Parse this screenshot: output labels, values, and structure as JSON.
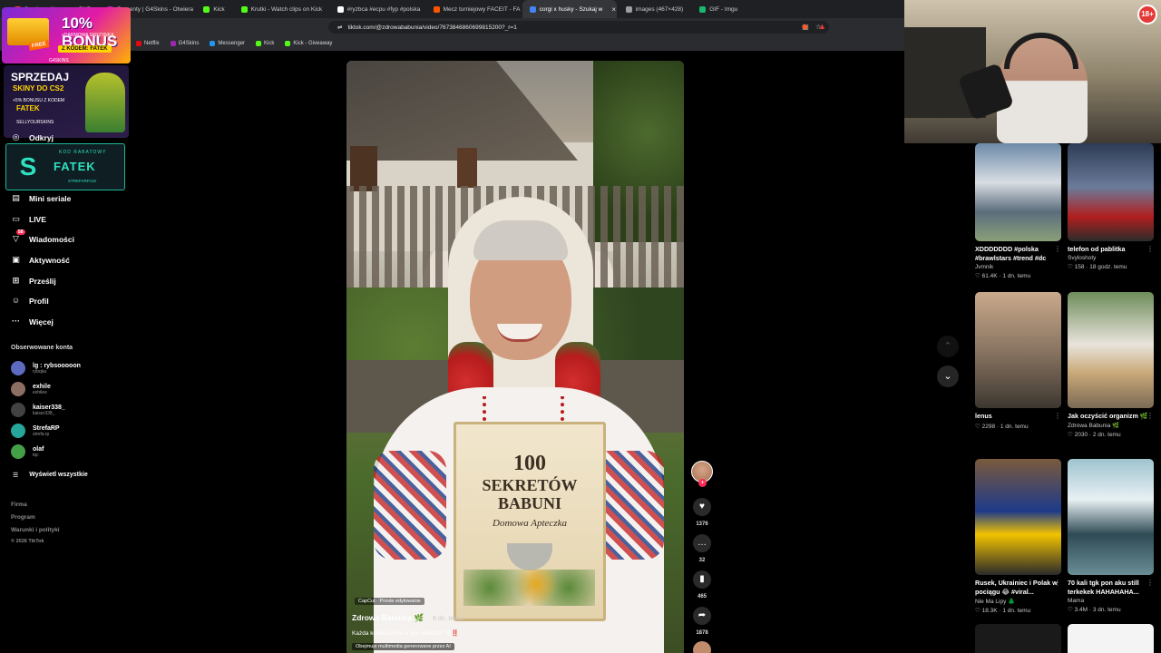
{
  "browser": {
    "tabs": [
      {
        "label": "Sentino x Koneser x BNP",
        "color": "#e53935"
      },
      {
        "label": "Prezenty | G4Skins - Otwiera",
        "color": "#9c27b0"
      },
      {
        "label": "Kick",
        "color": "#53fc18"
      },
      {
        "label": "Krutki - Watch clips on Kick",
        "color": "#53fc18"
      },
      {
        "label": "#ryzbca #ecpu #fyp #polska",
        "color": "#ffffff"
      },
      {
        "label": "Mecz turniejowy FACEIT - FA",
        "color": "#ff5500"
      },
      {
        "label": "corgi x husky - Szukaj w",
        "color": "#4285f4",
        "active": true
      },
      {
        "label": "images (467×428)",
        "color": "#9e9e9e"
      },
      {
        "label": "GIF - Imgu",
        "color": "#1bb76e"
      }
    ],
    "url": "tiktok.com/@zdrowababunia/video/7673846860699815200?_r=1",
    "bookmarks": [
      {
        "label": "Netflix",
        "color": "#e50914"
      },
      {
        "label": "G4Skins",
        "color": "#9c27b0"
      },
      {
        "label": "Messenger",
        "color": "#2196f3"
      },
      {
        "label": "Kick",
        "color": "#53fc18"
      },
      {
        "label": "Kick - Giveaway",
        "color": "#53fc18"
      }
    ]
  },
  "overlays": {
    "bonus": {
      "big": "10% BONUS",
      "sub": "+DARMOWA SKRZYNKA",
      "code": "Z KODEM: FATEK",
      "free": "FREE",
      "brand": "G4SKINS"
    },
    "sell": {
      "line1": "SPRZEDAJ",
      "line2": "SKINY DO CS2",
      "line3": "+5% BONUSU Z KODEM",
      "line4": "FATEK",
      "line5": "SELLYOURSKINS"
    },
    "strefa": {
      "logo": "S",
      "kod": "KOD RABATOWY",
      "name": "FATEK",
      "site": "STREFARP.GG"
    }
  },
  "sidebar": {
    "nav": [
      {
        "icon": "compass-icon",
        "glyph": "◎",
        "label": "Odkryj"
      },
      {
        "icon": "film-icon",
        "glyph": "▤",
        "label": "Mini seriale"
      },
      {
        "icon": "live-icon",
        "glyph": "▭",
        "label": "LIVE"
      },
      {
        "icon": "message-icon",
        "glyph": "▽",
        "label": "Wiadomości",
        "badge": "58"
      },
      {
        "icon": "activity-icon",
        "glyph": "▣",
        "label": "Aktywność"
      },
      {
        "icon": "upload-icon",
        "glyph": "⊞",
        "label": "Prześlij"
      },
      {
        "icon": "profile-icon",
        "glyph": "☺",
        "label": "Profil"
      },
      {
        "icon": "more-icon",
        "glyph": "···",
        "label": "Więcej"
      }
    ],
    "following_title": "Obserwowane konta",
    "following": [
      {
        "name": "lg : rybsooooon",
        "handle": "rybqka",
        "color": "#5c6bc0"
      },
      {
        "name": "exhile",
        "handle": "exhilee",
        "color": "#8d6e63"
      },
      {
        "name": "kaiser338_",
        "handle": "kaiser338_",
        "color": "#424242"
      },
      {
        "name": "StrefaRP",
        "handle": "strefa.rp",
        "color": "#26a69a"
      },
      {
        "name": "olaf",
        "handle": "tqc",
        "color": "#43a047"
      }
    ],
    "show_all": "Wyświetl wszystkie",
    "footer": [
      "Firma",
      "Program",
      "Warunki i polityki",
      "© 2026 TikTok"
    ]
  },
  "video": {
    "book": {
      "number": "100",
      "line1": "SEKRETÓW",
      "line2": "BABUNI",
      "line3": "Domowa Apteczka"
    },
    "capcut": "CapCut · Proste edytowanie",
    "author": "Zdrowa Babunia 🌿",
    "ago": "6 dn. temu",
    "caption": "Każda kobieta musi o tym wiedzieć 😵‼️",
    "ai_label": "Obejmuje multimedia generowane przez AI"
  },
  "rail": {
    "likes": "1376",
    "comments": "32",
    "saves": "465",
    "shares": "1878"
  },
  "related": [
    {
      "title": "XDDDDDDD #polska #brawlstars #trend #dc",
      "by": "Jvmnik",
      "stats": "♡ 61.4K · 1 dn. temu",
      "bg": "linear-gradient(180deg,#6d8aa8,#d9dde3 40%,#5b6d7c 70%,#8aa07a)"
    },
    {
      "title": "telefon od pablitka",
      "by": "Svyloshoty",
      "stats": "♡ 158 · 18 godz. temu",
      "bg": "linear-gradient(180deg,#2d3b55,#6b7b9a 45%,#b01e1e 75%,#2c2c2c)"
    },
    {
      "title": "lenus",
      "by": "",
      "stats": "♡ 2298 · 1 dn. temu",
      "bg": "linear-gradient(180deg,#caa98b,#8a7562 50%,#3d3730)"
    },
    {
      "title": "Jak oczyścić organizm 🌿",
      "by": "Zdrowa Babunia 🌿",
      "stats": "♡ 2030 · 2 dn. temu",
      "bg": "linear-gradient(180deg,#6e8c5a,#e9e4dc 45%,#c9a878 70%,#7b6a55)"
    },
    {
      "title": "Rusek, Ukrainiec i Polak w pociągu 😂 #viral...",
      "by": "Nie Ma Lipy 🌲",
      "stats": "♡ 18.3K · 1 dn. temu",
      "bg": "linear-gradient(180deg,#7a5a3c,#1e3a8a 45%,#f2c300 65%,#2a2a2a)"
    },
    {
      "title": "70 kali tgk pon aku still terkekek HAHAHAHA...",
      "by": "Mama",
      "stats": "♡ 3.4M · 3 dn. temu",
      "bg": "linear-gradient(180deg,#9fc3cf,#e8f1f4 35%,#2f4b55 65%,#6a8d96)"
    }
  ],
  "age_badge": "18+"
}
